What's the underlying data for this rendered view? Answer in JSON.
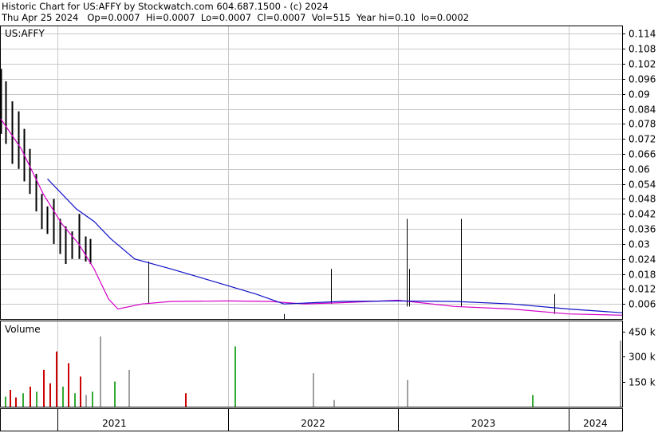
{
  "header": {
    "line1": "Historic Chart for US:AFFY by Stockwatch.com 604.687.1500 - (c) 2024",
    "line2": "Thu Apr 25 2024   Op=0.0007  Hi=0.0007  Lo=0.0007  Cl=0.0007  Vol=515  Year hi=0.10  lo=0.0002"
  },
  "colors": {
    "price_bar": "#000000",
    "price_bar_red": "#cc0000",
    "ma_short": "#d400c8",
    "ma_long": "#1010c8",
    "vol_up": "#33aa33",
    "vol_down": "#cc0000",
    "vol_neutral": "#a0a0a0",
    "grid": "#c8c8c8"
  },
  "chart_data": [
    {
      "type": "ohlc",
      "title": "US:AFFY",
      "ylim": [
        0,
        0.117
      ],
      "y_ticks": [
        0.114,
        0.108,
        0.102,
        0.096,
        0.09,
        0.084,
        0.078,
        0.072,
        0.066,
        0.06,
        0.054,
        0.048,
        0.042,
        0.036,
        0.03,
        0.024,
        0.018,
        0.012,
        0.006
      ],
      "x_ticks": [
        "2021",
        "2022",
        "2023",
        "2024"
      ],
      "x_range": [
        "2020-09-01",
        "2024-04-25"
      ],
      "grid": true,
      "price_high_low": [
        {
          "x": "2020-09-01",
          "high": 0.1,
          "low": 0.074
        },
        {
          "x": "2020-09-12",
          "high": 0.095,
          "low": 0.07
        },
        {
          "x": "2020-09-25",
          "high": 0.087,
          "low": 0.062
        },
        {
          "x": "2020-10-08",
          "high": 0.083,
          "low": 0.06
        },
        {
          "x": "2020-10-20",
          "high": 0.076,
          "low": 0.055
        },
        {
          "x": "2020-11-02",
          "high": 0.068,
          "low": 0.05
        },
        {
          "x": "2020-11-15",
          "high": 0.058,
          "low": 0.043
        },
        {
          "x": "2020-11-28",
          "high": 0.05,
          "low": 0.036
        },
        {
          "x": "2020-12-10",
          "high": 0.045,
          "low": 0.034
        },
        {
          "x": "2020-12-22",
          "high": 0.048,
          "low": 0.03
        },
        {
          "x": "2021-01-05",
          "high": 0.04,
          "low": 0.026
        },
        {
          "x": "2021-01-18",
          "high": 0.037,
          "low": 0.022
        },
        {
          "x": "2021-02-01",
          "high": 0.035,
          "low": 0.024
        },
        {
          "x": "2021-02-15",
          "high": 0.042,
          "low": 0.024
        },
        {
          "x": "2021-03-01",
          "high": 0.033,
          "low": 0.023
        },
        {
          "x": "2021-03-12",
          "high": 0.032,
          "low": 0.022
        }
      ],
      "spikes": [
        {
          "x": "2021-07-15",
          "high": 0.023,
          "low": 0.006
        },
        {
          "x": "2022-05-01",
          "high": 0.002,
          "low": 0.0
        },
        {
          "x": "2022-08-10",
          "high": 0.02,
          "low": 0.006
        },
        {
          "x": "2023-01-20",
          "high": 0.04,
          "low": 0.005
        },
        {
          "x": "2023-01-25",
          "high": 0.02,
          "low": 0.005
        },
        {
          "x": "2023-05-15",
          "high": 0.04,
          "low": 0.005
        },
        {
          "x": "2023-12-01",
          "high": 0.01,
          "low": 0.002
        }
      ],
      "series": [
        {
          "name": "",
          "x": [
            "2020-09-01",
            "2020-10-15",
            "2020-12-01",
            "2021-01-10",
            "2021-02-15",
            "2021-03-20",
            "2021-04-20",
            "2021-05-10",
            "2021-07-01",
            "2021-09-01",
            "2022-01-01",
            "2022-04-01",
            "2022-06-15",
            "2022-09-01",
            "2023-01-01",
            "2023-05-01",
            "2023-09-01",
            "2024-01-01",
            "2024-04-25"
          ],
          "y": [
            0.08,
            0.068,
            0.05,
            0.038,
            0.03,
            0.02,
            0.008,
            0.004,
            0.006,
            0.007,
            0.0072,
            0.007,
            0.006,
            0.0065,
            0.0075,
            0.005,
            0.004,
            0.002,
            0.0015
          ]
        },
        {
          "name": "",
          "x": [
            "2020-12-10",
            "2021-01-10",
            "2021-02-10",
            "2021-03-20",
            "2021-04-25",
            "2021-06-15",
            "2021-09-01",
            "2021-12-01",
            "2022-03-01",
            "2022-05-01",
            "2022-09-01",
            "2023-01-01",
            "2023-05-01",
            "2023-09-01",
            "2024-01-01",
            "2024-04-25"
          ],
          "y": [
            0.056,
            0.05,
            0.044,
            0.039,
            0.032,
            0.024,
            0.02,
            0.015,
            0.01,
            0.006,
            0.007,
            0.0072,
            0.007,
            0.006,
            0.004,
            0.0025
          ]
        }
      ]
    },
    {
      "type": "bar",
      "title": "Volume",
      "ylim": [
        0,
        510
      ],
      "y_ticks": [
        "450 k",
        "300 k",
        "150 k"
      ],
      "unit": "k",
      "bars": [
        {
          "x": "2020-09-10",
          "v": 60,
          "c": "up"
        },
        {
          "x": "2020-09-20",
          "v": 100,
          "c": "down"
        },
        {
          "x": "2020-10-01",
          "v": 55,
          "c": "down"
        },
        {
          "x": "2020-10-18",
          "v": 80,
          "c": "up"
        },
        {
          "x": "2020-11-01",
          "v": 120,
          "c": "down"
        },
        {
          "x": "2020-11-15",
          "v": 90,
          "c": "up"
        },
        {
          "x": "2020-12-01",
          "v": 220,
          "c": "down"
        },
        {
          "x": "2020-12-15",
          "v": 140,
          "c": "down"
        },
        {
          "x": "2020-12-28",
          "v": 330,
          "c": "down"
        },
        {
          "x": "2021-01-10",
          "v": 120,
          "c": "up"
        },
        {
          "x": "2021-01-22",
          "v": 260,
          "c": "down"
        },
        {
          "x": "2021-02-05",
          "v": 80,
          "c": "up"
        },
        {
          "x": "2021-02-18",
          "v": 180,
          "c": "down"
        },
        {
          "x": "2021-03-01",
          "v": 70,
          "c": "neutral"
        },
        {
          "x": "2021-03-15",
          "v": 90,
          "c": "up"
        },
        {
          "x": "2021-04-01",
          "v": 420,
          "c": "neutral"
        },
        {
          "x": "2021-05-01",
          "v": 150,
          "c": "up"
        },
        {
          "x": "2021-06-01",
          "v": 220,
          "c": "neutral"
        },
        {
          "x": "2021-10-01",
          "v": 80,
          "c": "down"
        },
        {
          "x": "2022-01-15",
          "v": 360,
          "c": "up"
        },
        {
          "x": "2022-07-01",
          "v": 200,
          "c": "neutral"
        },
        {
          "x": "2022-08-15",
          "v": 40,
          "c": "neutral"
        },
        {
          "x": "2023-01-20",
          "v": 160,
          "c": "neutral"
        },
        {
          "x": "2023-10-15",
          "v": 70,
          "c": "up"
        },
        {
          "x": "2024-04-20",
          "v": 395,
          "c": "neutral"
        }
      ]
    }
  ]
}
